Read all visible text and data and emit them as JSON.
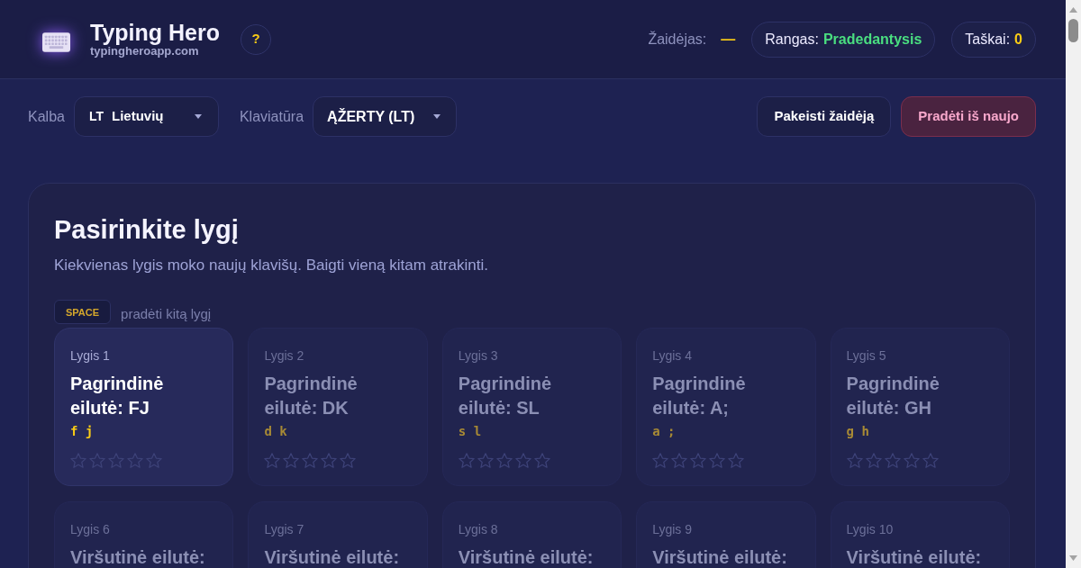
{
  "header": {
    "title": "Typing Hero",
    "subtitle": "typingheroapp.com",
    "help_button": "?",
    "player": {
      "label": "Žaidėjas:",
      "value": "—"
    },
    "rank": {
      "label": "Rangas:",
      "value": "Pradedantysis"
    },
    "score": {
      "label": "Taškai:",
      "value": "0"
    }
  },
  "toolbar": {
    "language": {
      "label": "Kalba",
      "code": "LT",
      "value": "Lietuvių"
    },
    "keyboard": {
      "label": "Klaviatūra",
      "value": "ĄŽERTY (LT)"
    },
    "buttons": [
      {
        "label": "Pakeisti žaidėją",
        "kind": "default"
      },
      {
        "label": "Pradėti iš naujo",
        "kind": "danger"
      }
    ]
  },
  "level_select": {
    "title": "Pasirinkite lygį",
    "description": "Kiekvienas lygis moko naujų klavišų. Baigti vieną kitam atrakinti.",
    "shortcut": {
      "key": "SPACE",
      "text": "pradėti kitą lygį"
    },
    "levels": [
      {
        "label": "Lygis 1",
        "title": "Pagrindinė eilutė: FJ",
        "keys": "f j",
        "locked": false,
        "stars": 0
      },
      {
        "label": "Lygis 2",
        "title": "Pagrindinė eilutė: DK",
        "keys": "d k",
        "locked": true,
        "stars": 0
      },
      {
        "label": "Lygis 3",
        "title": "Pagrindinė eilutė: SL",
        "keys": "s l",
        "locked": true,
        "stars": 0
      },
      {
        "label": "Lygis 4",
        "title": "Pagrindinė eilutė: A;",
        "keys": "a ;",
        "locked": true,
        "stars": 0
      },
      {
        "label": "Lygis 5",
        "title": "Pagrindinė eilutė: GH",
        "keys": "g h",
        "locked": true,
        "stars": 0
      },
      {
        "label": "Lygis 6",
        "title": "Viršutinė eilutė:",
        "locked": true
      },
      {
        "label": "Lygis 7",
        "title": "Viršutinė eilutė:",
        "locked": true
      },
      {
        "label": "Lygis 8",
        "title": "Viršutinė eilutė:",
        "locked": true
      },
      {
        "label": "Lygis 9",
        "title": "Viršutinė eilutė:",
        "locked": true
      },
      {
        "label": "Lygis 10",
        "title": "Viršutinė eilutė:",
        "locked": true
      }
    ]
  }
}
